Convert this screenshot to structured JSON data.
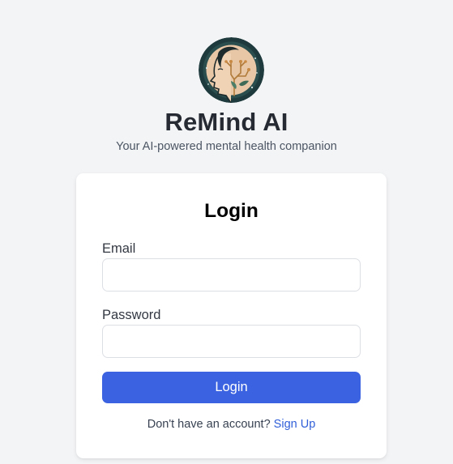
{
  "brand": {
    "name": "ReMind AI",
    "tagline": "Your AI-powered mental health companion",
    "logo_icon": "head-circuit-logo-icon"
  },
  "login_form": {
    "title": "Login",
    "email_label": "Email",
    "email_value": "",
    "password_label": "Password",
    "password_value": "",
    "submit_label": "Login",
    "signup_prompt": "Don't have an account?",
    "signup_link": "Sign Up"
  },
  "colors": {
    "background": "#f3f4f6",
    "primary_button": "#3b62e0",
    "link": "#2f5ed8",
    "card": "#ffffff"
  }
}
